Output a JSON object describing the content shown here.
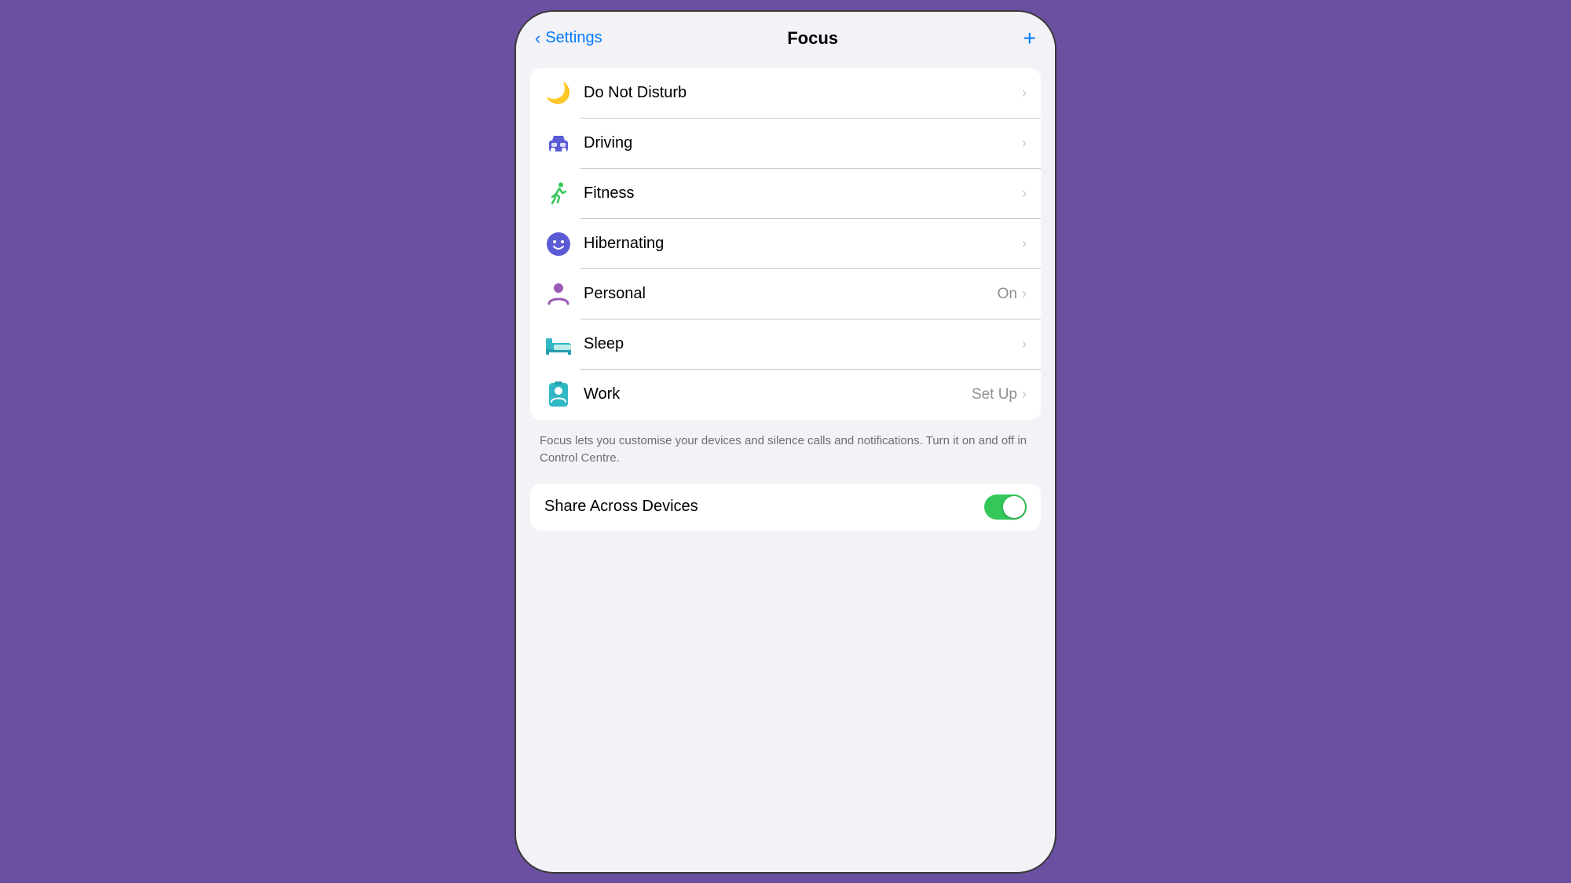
{
  "nav": {
    "back_label": "Settings",
    "title": "Focus",
    "add_label": "+"
  },
  "focus_items": [
    {
      "id": "do-not-disturb",
      "label": "Do Not Disturb",
      "icon_name": "moon-icon",
      "icon_unicode": "🌙",
      "status": "",
      "action": "chevron"
    },
    {
      "id": "driving",
      "label": "Driving",
      "icon_name": "car-icon",
      "icon_unicode": "🚘",
      "status": "",
      "action": "chevron"
    },
    {
      "id": "fitness",
      "label": "Fitness",
      "icon_name": "runner-icon",
      "icon_unicode": "🏃",
      "status": "",
      "action": "chevron"
    },
    {
      "id": "hibernating",
      "label": "Hibernating",
      "icon_name": "smile-icon",
      "icon_unicode": "😊",
      "status": "",
      "action": "chevron"
    },
    {
      "id": "personal",
      "label": "Personal",
      "icon_name": "person-icon",
      "icon_unicode": "👤",
      "status": "On",
      "action": "chevron"
    },
    {
      "id": "sleep",
      "label": "Sleep",
      "icon_name": "bed-icon",
      "icon_unicode": "🛏",
      "status": "",
      "action": "chevron"
    },
    {
      "id": "work",
      "label": "Work",
      "icon_name": "badge-icon",
      "icon_unicode": "🪪",
      "status": "Set Up",
      "action": "chevron"
    }
  ],
  "description": "Focus lets you customise your devices and silence calls and notifications. Turn it on and off in Control Centre.",
  "share_across_devices": {
    "label": "Share Across Devices",
    "enabled": true
  },
  "chevron": "›"
}
